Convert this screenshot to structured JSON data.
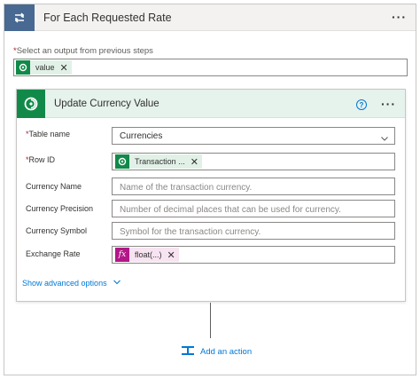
{
  "loop": {
    "title": "For Each Requested Rate",
    "output_label": "Select an output from previous steps",
    "output_token": "value"
  },
  "action": {
    "title": "Update Currency Value",
    "help": "?",
    "fields": {
      "table_name": {
        "label": "Table name",
        "value": "Currencies"
      },
      "row_id": {
        "label": "Row ID",
        "token": "Transaction ..."
      },
      "currency_name": {
        "label": "Currency Name",
        "placeholder": "Name of the transaction currency."
      },
      "currency_precision": {
        "label": "Currency Precision",
        "placeholder": "Number of decimal places that can be used for currency."
      },
      "currency_symbol": {
        "label": "Currency Symbol",
        "placeholder": "Symbol for the transaction currency."
      },
      "exchange_rate": {
        "label": "Exchange Rate",
        "token": "float(...)",
        "token_icon": "fx"
      }
    },
    "advanced_label": "Show advanced options"
  },
  "add_action_label": "Add an action",
  "required_marker": "*",
  "remove_glyph": "✕",
  "more_glyph": "···",
  "colors": {
    "loop_accent": "#486991",
    "dataverse_green": "#118a49",
    "expression_purple": "#b21788",
    "link_blue": "#0078d4"
  },
  "icons": [
    "loop-icon",
    "dataverse-icon",
    "help-icon",
    "more-icon",
    "remove-icon",
    "chevron-down-icon",
    "fx-icon",
    "add-action-icon"
  ]
}
